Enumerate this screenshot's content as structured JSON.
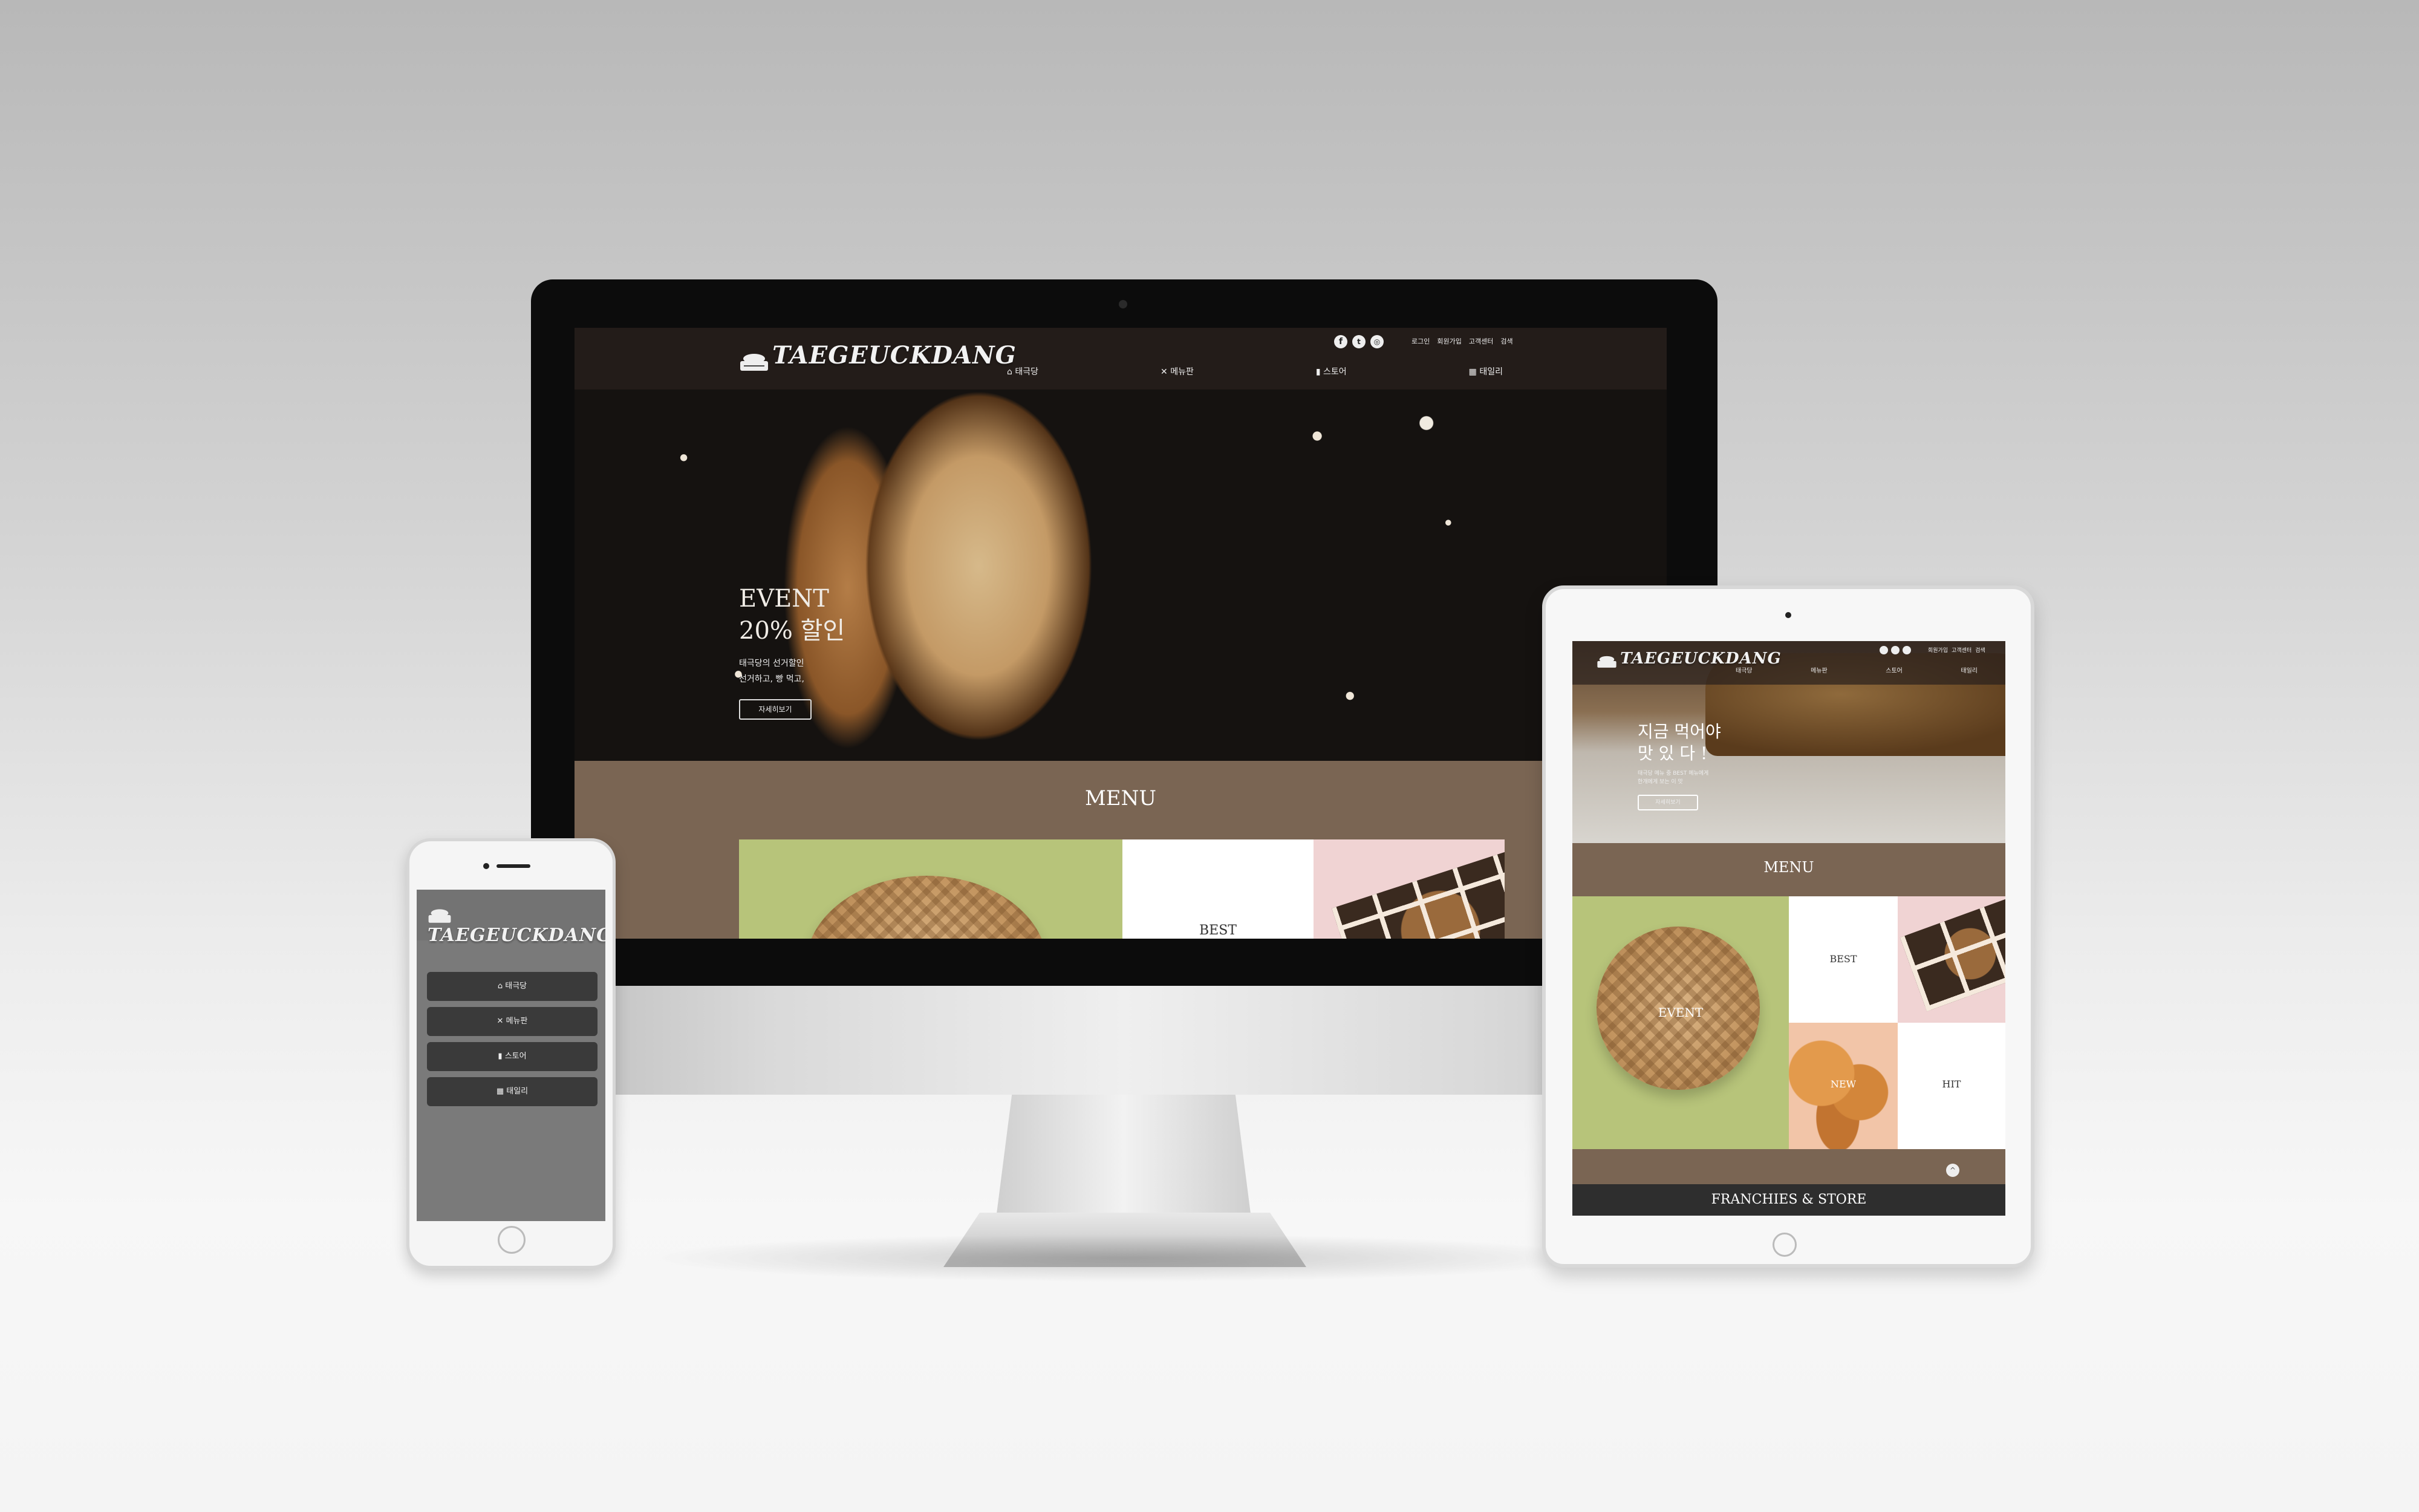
{
  "brand": {
    "logo": "TAEGEUCKDANG"
  },
  "desktop": {
    "nav": [
      {
        "label": "태극당",
        "icon": "home-icon"
      },
      {
        "label": "메뉴판",
        "icon": "utensils-icon"
      },
      {
        "label": "스토어",
        "icon": "store-icon"
      },
      {
        "label": "태일리",
        "icon": "calendar-icon"
      }
    ],
    "util_links": [
      "로그인",
      "회원가입",
      "고객센터",
      "검색"
    ],
    "social": [
      "facebook-icon",
      "twitter-icon",
      "instagram-icon"
    ],
    "hero": {
      "title1": "EVENT",
      "title2": "20% 할인",
      "desc1": "태극당의 선거할인",
      "desc2": "선거하고, 빵 먹고,",
      "button": "자세히보기"
    },
    "menu_section": {
      "title": "MENU",
      "tile_best": "BEST"
    }
  },
  "tablet": {
    "util_links": [
      "회원가입",
      "고객센터",
      "검색"
    ],
    "nav": [
      "태극당",
      "메뉴판",
      "스토어",
      "태일리"
    ],
    "hero": {
      "title1": "지금 먹어야",
      "title2": "맛 있 다 !",
      "desc1": "태극당 메뉴 중 BEST 메뉴에게",
      "desc2": "한개에게 보는 이 맛",
      "button": "자세히보기"
    },
    "menu_section": {
      "title": "MENU",
      "tiles": {
        "event": "EVENT",
        "best": "BEST",
        "new": "NEW",
        "hit": "HIT"
      }
    },
    "franchise_title": "FRANCHIES & STORE"
  },
  "phone": {
    "menu": [
      {
        "label": "태극당",
        "icon": "home-icon"
      },
      {
        "label": "메뉴판",
        "icon": "utensils-icon"
      },
      {
        "label": "스토어",
        "icon": "store-icon"
      },
      {
        "label": "태일리",
        "icon": "calendar-icon"
      }
    ]
  },
  "colors": {
    "brown": "#7a6553",
    "green": "#b7c47a",
    "peach": "#f4c9aa",
    "pink": "#f0d3d3",
    "dark": "#151210"
  }
}
